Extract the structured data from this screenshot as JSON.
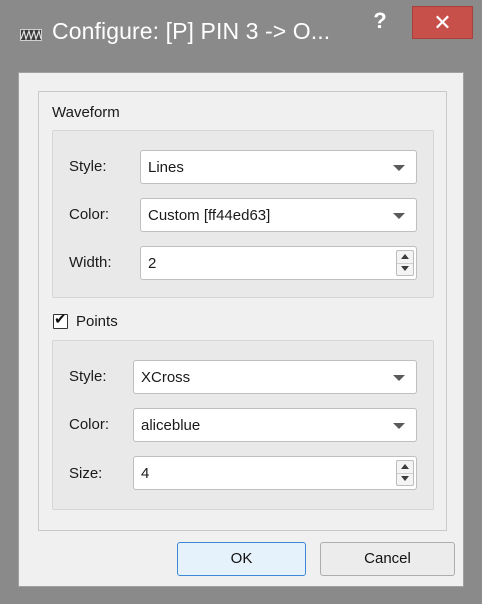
{
  "window": {
    "title": "Configure: [P] PIN 3 -> O...",
    "help_glyph": "?",
    "close_glyph": "✕",
    "icon": "waveform-app-icon"
  },
  "waveform": {
    "section_label": "Waveform",
    "style": {
      "label": "Style:",
      "value": "Lines"
    },
    "color": {
      "label": "Color:",
      "value": "Custom [ff44ed63]"
    },
    "width": {
      "label": "Width:",
      "value": "2"
    }
  },
  "points": {
    "checkbox_label": "Points",
    "checked": true,
    "check_glyph": "✔",
    "style": {
      "label": "Style:",
      "value": "XCross"
    },
    "color": {
      "label": "Color:",
      "value": "aliceblue"
    },
    "size": {
      "label": "Size:",
      "value": "4"
    }
  },
  "buttons": {
    "ok": "OK",
    "cancel": "Cancel"
  },
  "colors": {
    "titlebar": "#8a8a8a",
    "close": "#c7504b",
    "dialog_bg": "#f0f0f0",
    "ok_border": "#3c88d6"
  }
}
